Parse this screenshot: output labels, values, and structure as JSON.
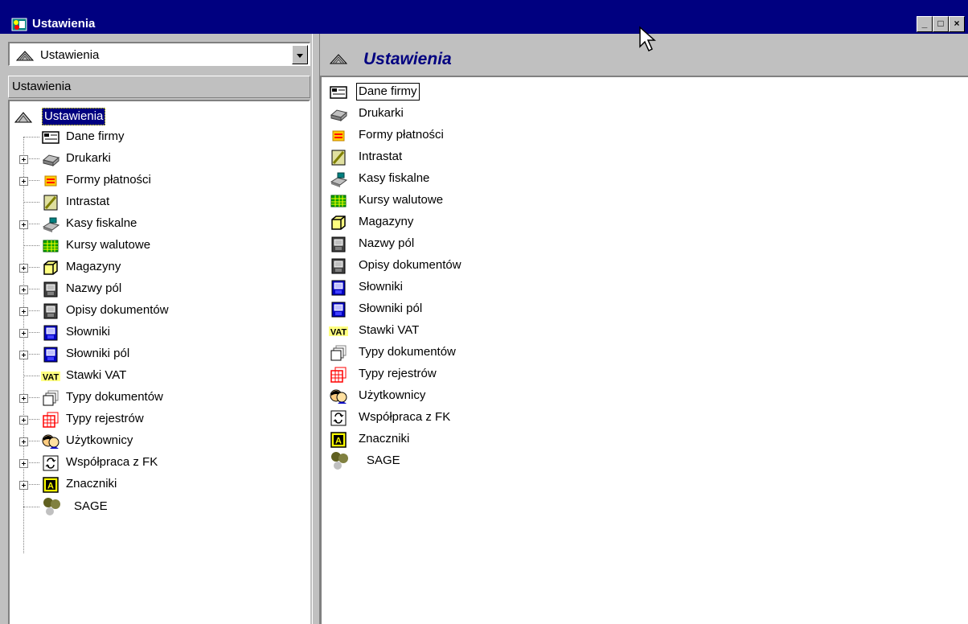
{
  "window": {
    "title": "Ustawienia",
    "controls": {
      "minimize": "_",
      "maximize": "□",
      "close": "×"
    },
    "title_bar_color": "#000080"
  },
  "left_panel": {
    "combo_value": "Ustawienia",
    "header": "Ustawienia",
    "tree_root": {
      "label": "Ustawienia",
      "icon": "settings-hat-icon",
      "selected": true
    },
    "tree_items": [
      {
        "label": "Dane firmy",
        "icon": "company-card-icon",
        "expandable": false
      },
      {
        "label": "Drukarki",
        "icon": "printer-icon",
        "expandable": true
      },
      {
        "label": "Formy płatności",
        "icon": "payment-icon",
        "expandable": true
      },
      {
        "label": "Intrastat",
        "icon": "intrastat-icon",
        "expandable": false
      },
      {
        "label": "Kasy fiskalne",
        "icon": "cash-register-icon",
        "expandable": true
      },
      {
        "label": "Kursy walutowe",
        "icon": "currency-grid-icon",
        "expandable": false
      },
      {
        "label": "Magazyny",
        "icon": "warehouse-box-icon",
        "expandable": true
      },
      {
        "label": "Nazwy pól",
        "icon": "field-names-icon",
        "expandable": true
      },
      {
        "label": "Opisy dokumentów",
        "icon": "document-descriptions-icon",
        "expandable": true
      },
      {
        "label": "Słowniki",
        "icon": "dictionary-icon",
        "expandable": true
      },
      {
        "label": "Słowniki pól",
        "icon": "field-dictionary-icon",
        "expandable": true
      },
      {
        "label": "Stawki VAT",
        "icon": "vat-icon",
        "expandable": false
      },
      {
        "label": "Typy dokumentów",
        "icon": "document-types-icon",
        "expandable": true
      },
      {
        "label": "Typy rejestrów",
        "icon": "register-types-icon",
        "expandable": true
      },
      {
        "label": "Użytkownicy",
        "icon": "users-icon",
        "expandable": true
      },
      {
        "label": "Współpraca z FK",
        "icon": "fk-sync-icon",
        "expandable": true
      },
      {
        "label": "Znaczniki",
        "icon": "markers-icon",
        "expandable": true
      },
      {
        "label": "SAGE",
        "icon": "sage-logo-icon",
        "expandable": false
      }
    ]
  },
  "right_panel": {
    "title": "Ustawienia",
    "title_color": "#000080",
    "items": [
      {
        "label": "Dane firmy",
        "icon": "company-card-icon",
        "focused": true
      },
      {
        "label": "Drukarki",
        "icon": "printer-icon"
      },
      {
        "label": "Formy płatności",
        "icon": "payment-icon"
      },
      {
        "label": "Intrastat",
        "icon": "intrastat-icon"
      },
      {
        "label": "Kasy fiskalne",
        "icon": "cash-register-icon"
      },
      {
        "label": "Kursy walutowe",
        "icon": "currency-grid-icon"
      },
      {
        "label": "Magazyny",
        "icon": "warehouse-box-icon"
      },
      {
        "label": "Nazwy pól",
        "icon": "field-names-icon"
      },
      {
        "label": "Opisy dokumentów",
        "icon": "document-descriptions-icon"
      },
      {
        "label": "Słowniki",
        "icon": "dictionary-icon"
      },
      {
        "label": "Słowniki pól",
        "icon": "field-dictionary-icon"
      },
      {
        "label": "Stawki VAT",
        "icon": "vat-icon"
      },
      {
        "label": "Typy dokumentów",
        "icon": "document-types-icon"
      },
      {
        "label": "Typy rejestrów",
        "icon": "register-types-icon"
      },
      {
        "label": "Użytkownicy",
        "icon": "users-icon"
      },
      {
        "label": "Współpraca z FK",
        "icon": "fk-sync-icon"
      },
      {
        "label": "Znaczniki",
        "icon": "markers-icon"
      },
      {
        "label": "SAGE",
        "icon": "sage-logo-icon"
      }
    ]
  },
  "icon_labels": {
    "vat": "VAT",
    "markers": "A"
  }
}
